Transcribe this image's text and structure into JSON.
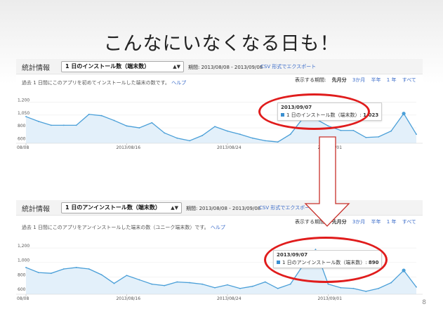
{
  "slide": {
    "title": "こんなにいなくなる日も！",
    "page_number": "8"
  },
  "colors": {
    "line": "#4a9fd8",
    "area": "#e3f0fa",
    "highlight": "#e01c1c"
  },
  "panels": [
    {
      "stat_label": "統計情報",
      "metric_selected": "1 日のインストール数（端末数）",
      "period": "期間: 2013/08/08 - 2013/09/08",
      "csv_link": "CSV 形式でエクスポート",
      "description": "過去 1 日間にこのアプリを初めてインストールした端末の数です。",
      "help": "ヘルプ",
      "range_label": "表示する期間:",
      "ranges": [
        "先月分",
        "3か月",
        "半年",
        "1 年",
        "すべて"
      ],
      "tooltip_date": "2013/09/07",
      "tooltip_text": "1 日のインストール数（端末数）: ",
      "tooltip_value": "1,023",
      "y_ticks": [
        "1,200",
        "1,050",
        "800",
        "600"
      ],
      "x_ticks": [
        "08/08",
        "2013/08/16",
        "2013/08/24",
        "2013/09/01"
      ]
    },
    {
      "stat_label": "統計情報",
      "metric_selected": "1 日のアンインストール数（端末数）",
      "period": "期間: 2013/08/08 - 2013/09/08",
      "csv_link": "CSV 形式でエクスポート",
      "description": "過去 1 日間にこのアプリをアンインストールした端末の数（ユニーク端末数）です。",
      "help": "ヘルプ",
      "range_label": "表示する期間:",
      "ranges": [
        "先月分",
        "3か月",
        "半年",
        "1 年",
        "すべて"
      ],
      "tooltip_date": "2013/09/07",
      "tooltip_text": "1 日のアンインストール数（端末数）: ",
      "tooltip_value": "890",
      "y_ticks": [
        "1,200",
        "1,000",
        "800",
        "600"
      ],
      "x_ticks": [
        "08/08",
        "2013/08/16",
        "2013/08/24",
        "2013/09/01"
      ]
    }
  ],
  "chart_data": [
    {
      "type": "area",
      "title": "1 日のインストール数（端末数）",
      "ylim": [
        560,
        1260
      ],
      "x": [
        "08/08",
        "08/09",
        "08/10",
        "08/11",
        "08/12",
        "08/13",
        "08/14",
        "08/15",
        "08/16",
        "08/17",
        "08/18",
        "08/19",
        "08/20",
        "08/21",
        "08/22",
        "08/23",
        "08/24",
        "08/25",
        "08/26",
        "08/27",
        "08/28",
        "08/29",
        "08/30",
        "08/31",
        "09/01",
        "09/02",
        "09/03",
        "09/04",
        "09/05",
        "09/06",
        "09/07",
        "09/08"
      ],
      "values": [
        975,
        900,
        840,
        840,
        840,
        1010,
        990,
        915,
        830,
        800,
        880,
        720,
        640,
        600,
        680,
        820,
        750,
        700,
        640,
        600,
        580,
        700,
        950,
        940,
        830,
        760,
        760,
        650,
        660,
        750,
        1023,
        700
      ]
    },
    {
      "type": "area",
      "title": "1 日のアンインストール数（端末数）",
      "ylim": [
        560,
        1260
      ],
      "x": [
        "08/08",
        "08/09",
        "08/10",
        "08/11",
        "08/12",
        "08/13",
        "08/14",
        "08/15",
        "08/16",
        "08/17",
        "08/18",
        "08/19",
        "08/20",
        "08/21",
        "08/22",
        "08/23",
        "08/24",
        "08/25",
        "08/26",
        "08/27",
        "08/28",
        "08/29",
        "08/30",
        "08/31",
        "09/01",
        "09/02",
        "09/03",
        "09/04",
        "09/05",
        "09/06",
        "09/07",
        "09/08"
      ],
      "values": [
        930,
        860,
        850,
        910,
        930,
        910,
        830,
        710,
        820,
        760,
        700,
        680,
        730,
        720,
        700,
        650,
        690,
        640,
        670,
        730,
        640,
        700,
        960,
        1180,
        700,
        650,
        640,
        600,
        640,
        720,
        890,
        660
      ]
    }
  ]
}
